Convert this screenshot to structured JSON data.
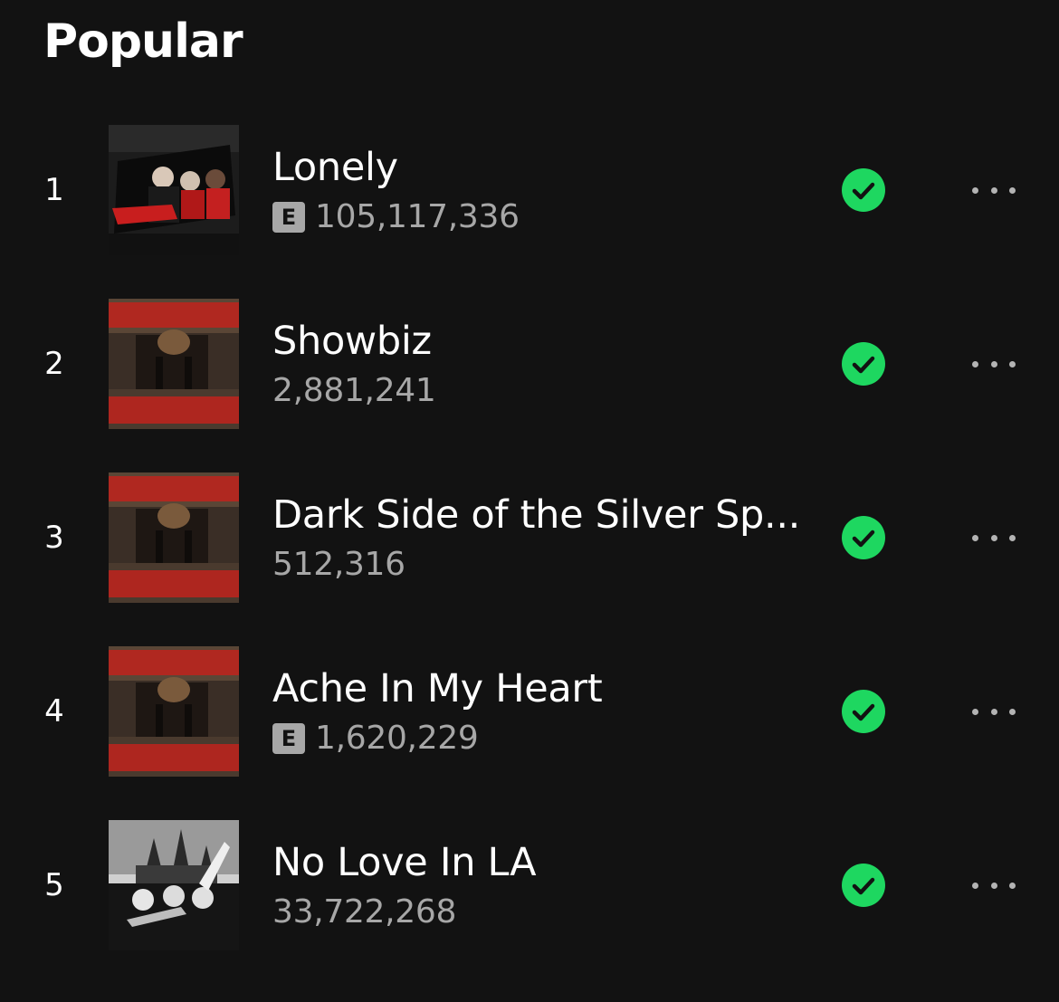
{
  "section": {
    "title": "Popular"
  },
  "colors": {
    "background": "#121212",
    "accent": "#1ed760",
    "secondary_text": "#a7a7a7"
  },
  "icons": {
    "saved": "check-circle-icon",
    "more": "more-options-icon",
    "explicit": "explicit-badge"
  },
  "tracks": [
    {
      "rank": "1",
      "title": "Lonely",
      "explicit": true,
      "explicit_label": "E",
      "plays": "105,117,336",
      "saved": true
    },
    {
      "rank": "2",
      "title": "Showbiz",
      "explicit": false,
      "plays": "2,881,241",
      "saved": true
    },
    {
      "rank": "3",
      "title": "Dark Side of the Silver Sp...",
      "explicit": false,
      "plays": "512,316",
      "saved": true
    },
    {
      "rank": "4",
      "title": "Ache In My Heart",
      "explicit": true,
      "explicit_label": "E",
      "plays": "1,620,229",
      "saved": true
    },
    {
      "rank": "5",
      "title": "No Love In LA",
      "explicit": false,
      "plays": "33,722,268",
      "saved": true
    }
  ]
}
